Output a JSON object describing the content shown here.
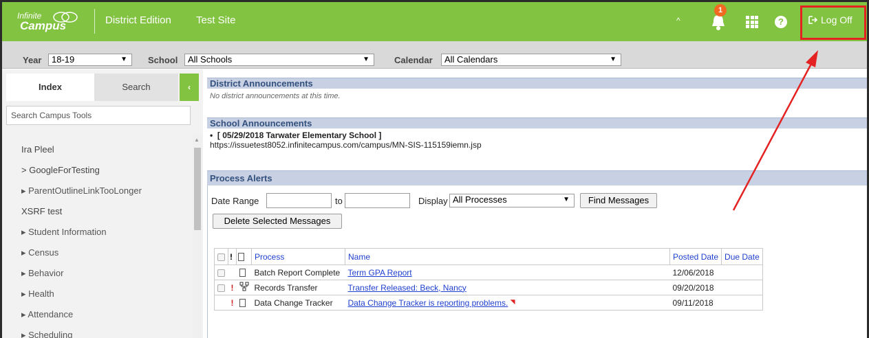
{
  "header": {
    "logo_line1": "Infinite",
    "logo_line2": "Campus",
    "edition": "District Edition",
    "site": "Test Site",
    "notification_count": "1",
    "help_glyph": "?",
    "logoff_label": "Log Off",
    "accent_color": "#82c341",
    "highlight_color": "#e52222"
  },
  "filters": {
    "year_label": "Year",
    "year_value": "18-19",
    "school_label": "School",
    "school_value": "All Schools",
    "calendar_label": "Calendar",
    "calendar_value": "All Calendars"
  },
  "sidebar": {
    "tab_index": "Index",
    "tab_search": "Search",
    "collapse_glyph": "‹",
    "search_placeholder": "Search Campus Tools",
    "items": [
      {
        "label": "Ira Pleel"
      },
      {
        "label": "> GoogleForTesting"
      },
      {
        "label": "▸ ParentOutlineLinkTooLonger"
      },
      {
        "label": "XSRF test"
      },
      {
        "label": "▸ Student Information"
      },
      {
        "label": "▸ Census"
      },
      {
        "label": "▸ Behavior"
      },
      {
        "label": "▸ Health"
      },
      {
        "label": "▸ Attendance"
      },
      {
        "label": "▸ Scheduling"
      }
    ]
  },
  "district": {
    "title": "District Announcements",
    "empty_text": "No district announcements at this time."
  },
  "school": {
    "title": "School Announcements",
    "entry_title": "[ 05/29/2018 Tarwater Elementary School ]",
    "entry_url": "https://issuetest8052.infinitecampus.com/campus/MN-SIS-115159iemn.jsp"
  },
  "alerts": {
    "title": "Process Alerts",
    "date_range_label": "Date Range",
    "to_label": "to",
    "display_label": "Display",
    "display_value": "All Processes",
    "find_button": "Find Messages",
    "delete_button": "Delete Selected Messages",
    "columns": {
      "process": "Process",
      "name": "Name",
      "posted": "Posted Date",
      "due": "Due Date"
    },
    "rows": [
      {
        "process": "Batch Report Complete",
        "name": "Term GPA Report",
        "posted": "12/06/2018",
        "due": ""
      },
      {
        "process": "Records Transfer",
        "name": "Transfer Released: Beck, Nancy",
        "posted": "09/20/2018",
        "due": ""
      },
      {
        "process": "Data Change Tracker",
        "name": "Data Change Tracker is reporting problems.",
        "posted": "09/11/2018",
        "due": ""
      }
    ]
  }
}
